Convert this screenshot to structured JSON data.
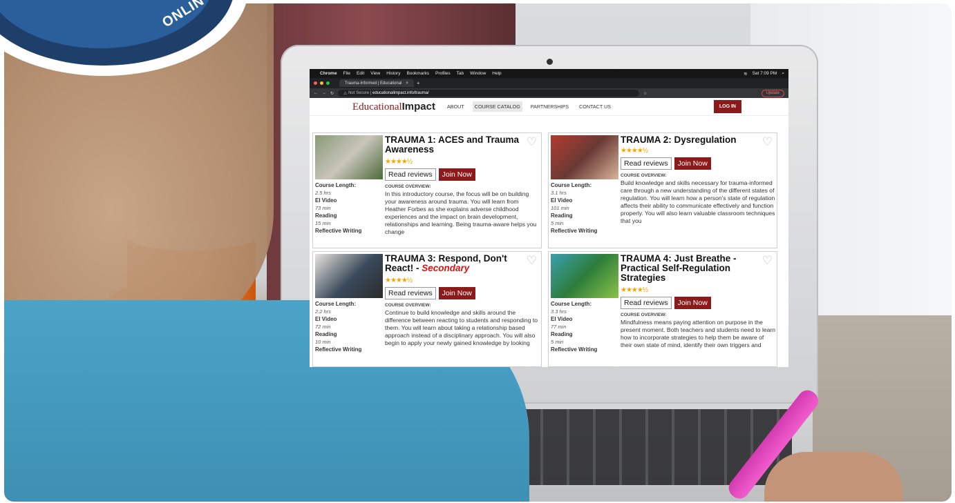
{
  "badge": {
    "text": "ONLIN"
  },
  "browser": {
    "menubar": [
      "Chrome",
      "File",
      "Edit",
      "View",
      "History",
      "Bookmarks",
      "Profiles",
      "Tab",
      "Window",
      "Help"
    ],
    "clock": "Sat 7:09 PM",
    "tab_title": "Trauma-Informed | Educational",
    "url_prefix": "Not Secure",
    "url": "educationalimpact.info/trauma/",
    "update_label": "Update"
  },
  "site": {
    "logo_part1": "Educational",
    "logo_part2": "Impact",
    "nav": [
      "ABOUT",
      "COURSE CATALOG",
      "PARTNERSHIPS",
      "CONTACT US"
    ],
    "login": "LOG IN"
  },
  "labels": {
    "course_length": "Course Length:",
    "ei_video": "EI Video",
    "reading": "Reading",
    "reflective": "Reflective Writing",
    "overview": "COURSE OVERVIEW:",
    "read_reviews": "Read reviews",
    "join_now": "Join Now",
    "stars": "★★★★½"
  },
  "courses": [
    {
      "title": "TRAUMA 1: ACES and Trauma Awareness",
      "secondary": "",
      "length": "2.5 hrs",
      "video": "73 min",
      "reading": "15 min",
      "desc": "In this introductory course, the focus will be on building your awareness around trauma. You will learn from Heather Forbes as she explains adverse childhood experiences and the impact on brain development, relationships and learning. Being trauma-aware helps you change"
    },
    {
      "title": "TRAUMA 2: Dysregulation",
      "secondary": "",
      "length": "3.1 hrs",
      "video": "101 min",
      "reading": "5 min",
      "desc": "Build knowledge and skills necessary for trauma-informed care through a new understanding of the different states of regulation. You will learn how a person's state of regulation affects their ability to communicate effectively and function properly. You will also learn valuable classroom techniques that you"
    },
    {
      "title": "TRAUMA 3: Respond, Don't React! - ",
      "secondary": "Secondary",
      "length": "2.2 hrs",
      "video": "72 min",
      "reading": "10 min",
      "desc": "Continue to build knowledge and skills around the difference between reacting to students and responding to them. You will learn about taking a relationship based approach instead of a disciplinary approach. You will also begin to apply your newly gained knowledge by looking"
    },
    {
      "title": "TRAUMA 4: Just Breathe - Practical Self-Regulation Strategies",
      "secondary": "",
      "length": "3.3 hrs",
      "video": "77 min",
      "reading": "5 min",
      "desc": "Mindfulness means paying attention on purpose in the present moment. Both teachers and students need to learn how to incorporate strategies to help them be aware of their own state of mind, identify their own triggers and"
    }
  ]
}
